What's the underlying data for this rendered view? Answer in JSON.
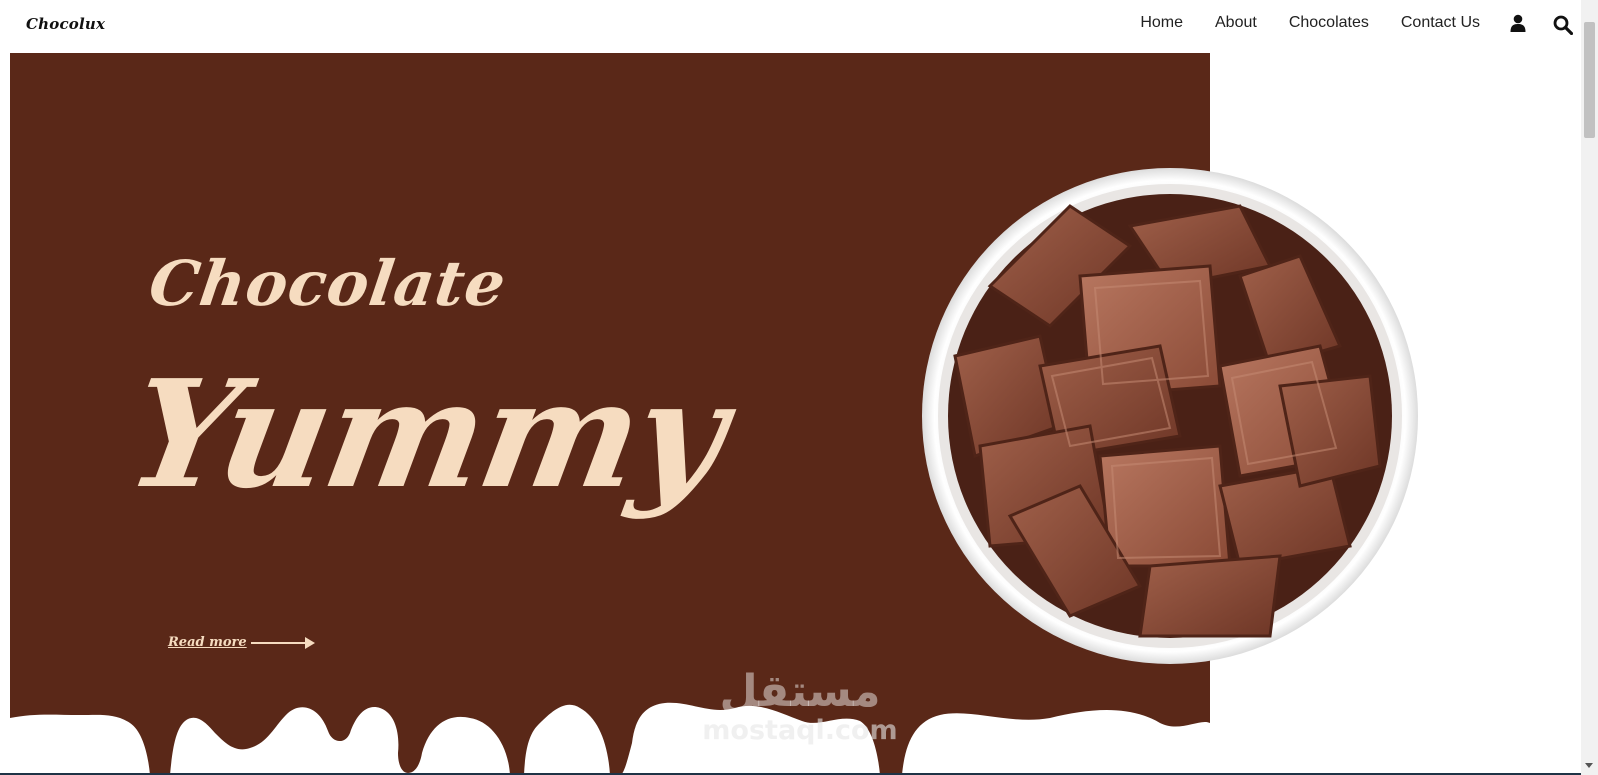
{
  "header": {
    "logo": "Chocolux",
    "nav": [
      "Home",
      "About",
      "Chocolates",
      "Contact Us"
    ],
    "icons": [
      "user-icon",
      "search-icon"
    ]
  },
  "hero": {
    "title_small": "Chocolate",
    "title_big": "Yummy",
    "read_more": "Read more"
  },
  "watermark": {
    "arabic": "مستقل",
    "latin": "mostaql.com"
  },
  "colors": {
    "hero_bg": "#5a2818",
    "script_text": "#f6dcc0",
    "page_bg": "#ffffff"
  }
}
